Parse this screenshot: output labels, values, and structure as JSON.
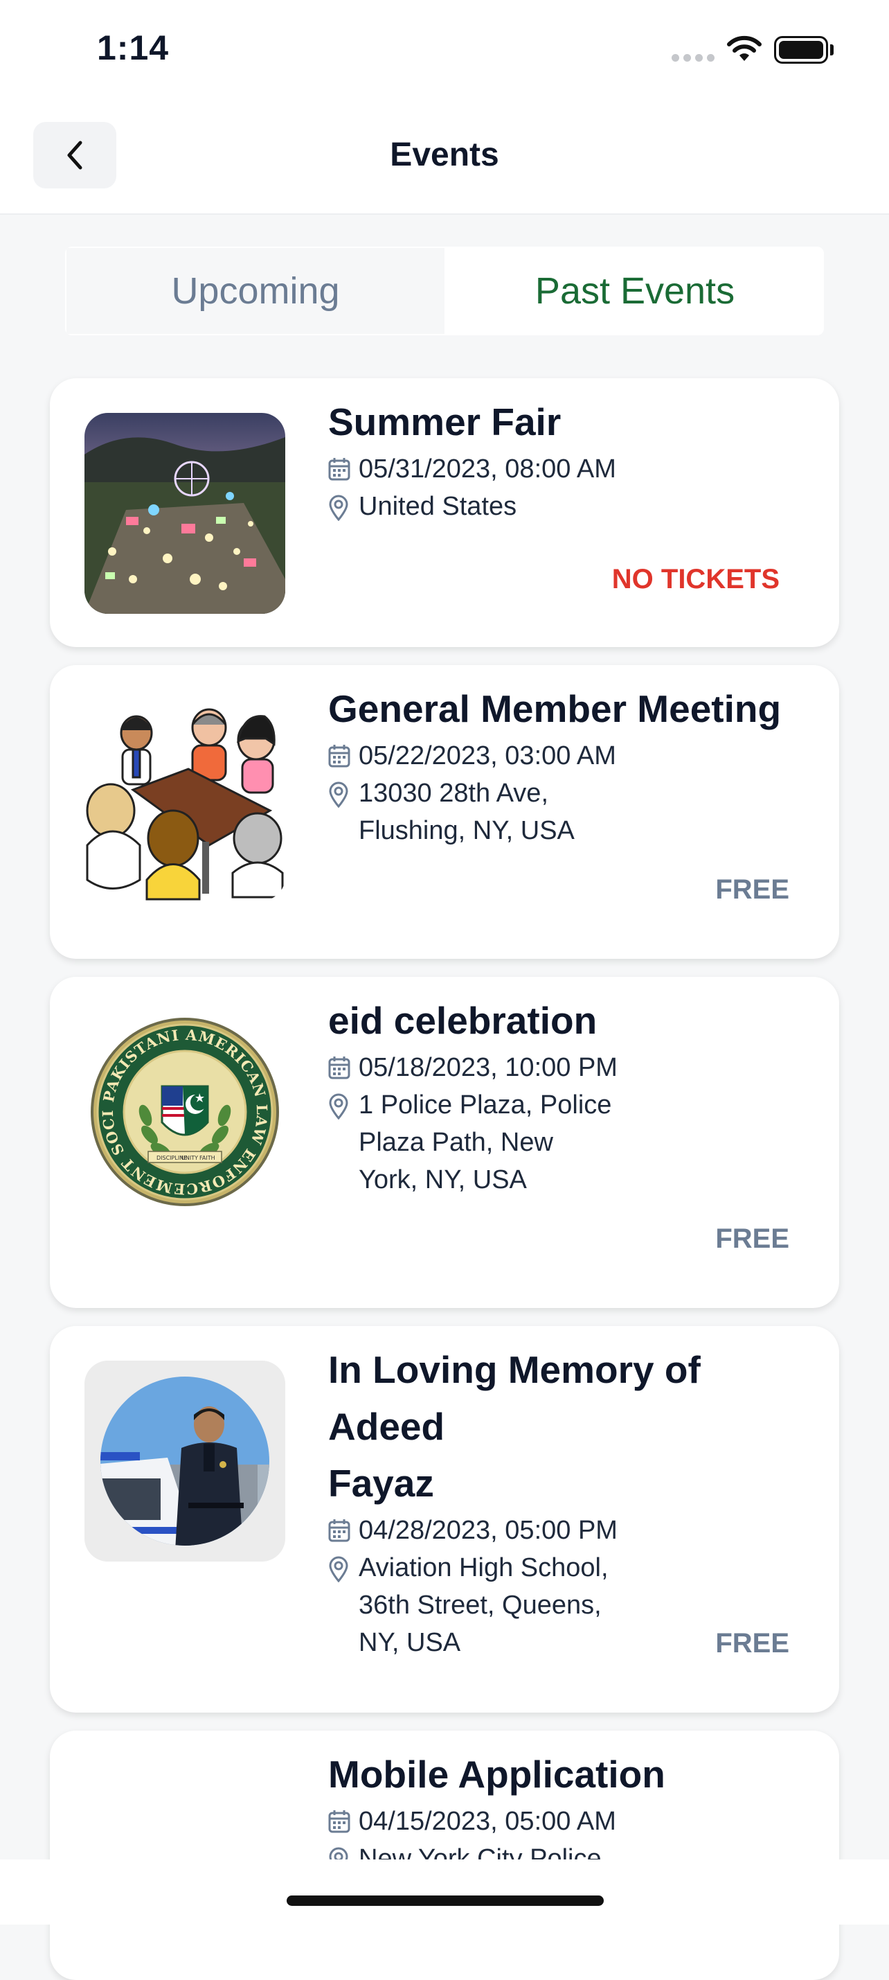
{
  "status_bar": {
    "time": "1:14"
  },
  "header": {
    "title": "Events",
    "back_icon": "chevron-left-icon"
  },
  "tabs": [
    {
      "label": "Upcoming",
      "selected": false
    },
    {
      "label": "Past Events",
      "selected": true
    }
  ],
  "colors": {
    "accent": "#1a6b35",
    "muted": "#6b7c93",
    "danger": "#e0352b"
  },
  "events": [
    {
      "title": "Summer Fair",
      "datetime": "05/31/2023, 08:00 AM",
      "location_lines": [
        "United States"
      ],
      "price": "NO TICKETS",
      "image": "fairground-aerial-photo"
    },
    {
      "title": "General Member Meeting",
      "datetime": "05/22/2023, 03:00 AM",
      "location_lines": [
        "13030 28th Ave,",
        "Flushing, NY, USA"
      ],
      "price": "FREE",
      "image": "people-around-table-illustration"
    },
    {
      "title": "eid celebration",
      "datetime": "05/18/2023, 10:00 PM",
      "location_lines": [
        "1 Police Plaza, Police",
        "Plaza Path, New",
        "York, NY, USA"
      ],
      "price": "FREE",
      "image": "society-seal-logo"
    },
    {
      "title_lines": [
        "In Loving Memory of Adeed",
        "Fayaz"
      ],
      "datetime": "04/28/2023, 05:00 PM",
      "location_lines": [
        "Aviation High School,",
        "36th Street, Queens,",
        "NY, USA"
      ],
      "price": "FREE",
      "image": "officer-portrait-photo"
    },
    {
      "title": "Mobile Application",
      "datetime": "04/15/2023, 05:00 AM",
      "location_lines": [
        "New York City Police"
      ],
      "image": "none"
    }
  ],
  "seal": {
    "ring_text": "PAKISTANI AMERICAN LAW ENFORCEMENT SOCIETY",
    "ribbon": [
      "DISCIPLINE",
      "UNITY",
      "FAITH"
    ]
  }
}
